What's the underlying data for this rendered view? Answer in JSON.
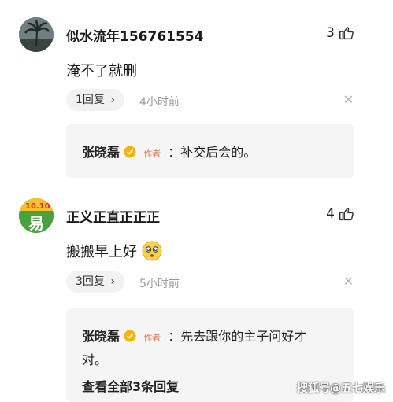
{
  "comments": [
    {
      "username": "似水流年156761554",
      "likes": "3",
      "text": "淹不了就删",
      "reply_count": "1回复",
      "time": "4小时前",
      "reply": {
        "author": "张晓磊",
        "tag": "作者",
        "text": "：补交后会的。"
      }
    },
    {
      "username": "正义正直正正正",
      "likes": "4",
      "text": "搬搬早上好",
      "emoji": "dizzy-face-emoji",
      "avatar_text": "易",
      "reply_count": "3回复",
      "time": "5小时前",
      "reply": {
        "author": "张晓磊",
        "tag": "作者",
        "text_line1": "：先去跟你的主子问好才",
        "text_line2": "对。",
        "view_all": "查看全部3条回复"
      }
    }
  ],
  "watermark": "搜狐号@五七娱乐",
  "icons": {
    "like": "thumbs-up-icon",
    "close": "close-icon",
    "chevron": "chevron-right-icon",
    "verify": "verified-badge-icon"
  },
  "colors": {
    "author_tag": "#e8734a",
    "verify_badge": "#f5b400",
    "reply_bg": "#f5f5f5"
  }
}
